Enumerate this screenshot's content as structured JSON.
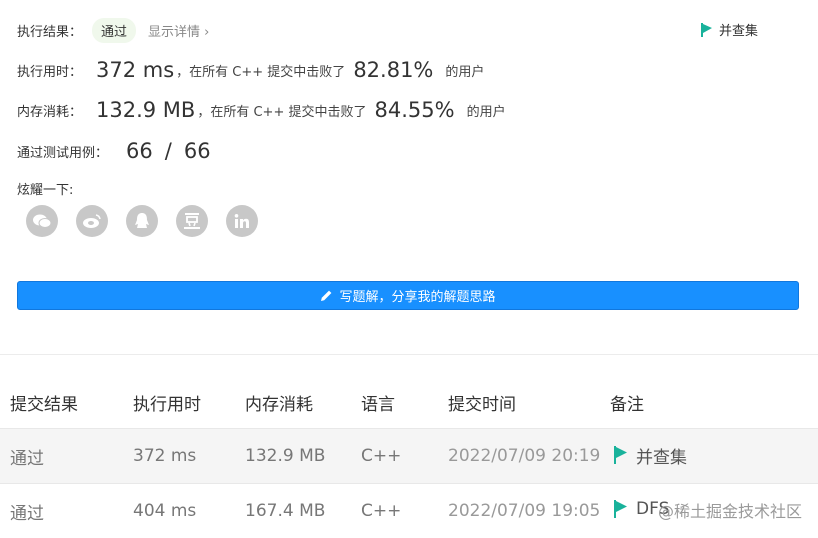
{
  "result": {
    "label": "执行结果：",
    "status": "通过",
    "details_link": "显示详情 ›",
    "tag": "并查集"
  },
  "runtime": {
    "label": "执行用时：",
    "value": "372 ms",
    "middle": "，在所有 C++ 提交中击败了",
    "percent": "82.81%",
    "suffix": "的用户"
  },
  "memory": {
    "label": "内存消耗：",
    "value": "132.9 MB",
    "middle": "，在所有 C++ 提交中击败了",
    "percent": "84.55%",
    "suffix": "的用户"
  },
  "tests": {
    "label": "通过测试用例：",
    "passed": "66",
    "sep": "/",
    "total": "66"
  },
  "share": {
    "label": "炫耀一下:",
    "icons": [
      "wechat-icon",
      "weibo-icon",
      "qq-icon",
      "douban-icon",
      "linkedin-icon"
    ]
  },
  "solution_button": "写题解，分享我的解题思路",
  "table": {
    "headers": [
      "提交结果",
      "执行用时",
      "内存消耗",
      "语言",
      "提交时间",
      "备注"
    ],
    "rows": [
      {
        "result": "通过",
        "time": "372 ms",
        "memory": "132.9 MB",
        "lang": "C++",
        "submitted": "2022/07/09 20:19",
        "note": "并查集"
      },
      {
        "result": "通过",
        "time": "404 ms",
        "memory": "167.4 MB",
        "lang": "C++",
        "submitted": "2022/07/09 19:05",
        "note": "DFS"
      }
    ]
  },
  "watermark": "@稀土掘金技术社区",
  "colors": {
    "accent_blue": "#1890ff",
    "success_green": "#5cb85c",
    "flag_teal": "#19b29b"
  }
}
